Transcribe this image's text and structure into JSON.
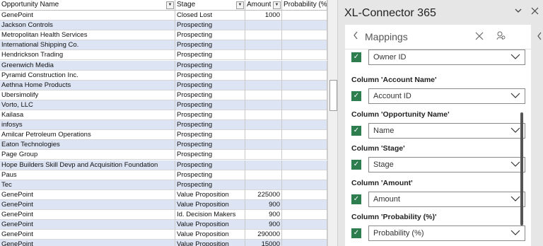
{
  "sheet": {
    "headers": [
      "Opportunity Name",
      "Stage",
      "Amount",
      "Probability (%"
    ],
    "rows": [
      [
        "GenePoint",
        "Closed Lost",
        "1000",
        ""
      ],
      [
        "Jackson Controls",
        "Prospecting",
        "",
        ""
      ],
      [
        "Metropolitan Health Services",
        "Prospecting",
        "",
        ""
      ],
      [
        "International Shipping Co.",
        "Prospecting",
        "",
        ""
      ],
      [
        "Hendrickson Trading",
        "Prospecting",
        "",
        ""
      ],
      [
        "Greenwich Media",
        "Prospecting",
        "",
        ""
      ],
      [
        "Pyramid Construction Inc.",
        "Prospecting",
        "",
        ""
      ],
      [
        "Aethna Home Products",
        "Prospecting",
        "",
        ""
      ],
      [
        "Ubersimolify",
        "Prospecting",
        "",
        ""
      ],
      [
        "Vorto, LLC",
        "Prospecting",
        "",
        ""
      ],
      [
        "Kailasa",
        "Prospecting",
        "",
        ""
      ],
      [
        "infosys",
        "Prospecting",
        "",
        ""
      ],
      [
        "Amilcar Petroleum Operations",
        "Prospecting",
        "",
        ""
      ],
      [
        "Eaton Technologies",
        "Prospecting",
        "",
        ""
      ],
      [
        "Page Group",
        "Prospecting",
        "",
        ""
      ],
      [
        "Hope Builders Skill Devp and Acquisition Foundation",
        "Prospecting",
        "",
        ""
      ],
      [
        "Paus",
        "Prospecting",
        "",
        ""
      ],
      [
        "Tec",
        "Prospecting",
        "",
        ""
      ],
      [
        "GenePoint",
        "Value Proposition",
        "225000",
        ""
      ],
      [
        "GenePoint",
        "Value Proposition",
        "900",
        ""
      ],
      [
        "GenePoint",
        "Id. Decision Makers",
        "900",
        ""
      ],
      [
        "GenePoint",
        "Value Proposition",
        "900",
        ""
      ],
      [
        "GenePoint",
        "Value Proposition",
        "290000",
        ""
      ],
      [
        "GenePoint",
        "Value Proposition",
        "15000",
        ""
      ]
    ],
    "cut_off_label": "on"
  },
  "pane": {
    "title": "XL-Connector 365",
    "panel_title": "Mappings",
    "first_select": "Owner ID",
    "mappings": [
      {
        "label": "Column 'Account Name'",
        "value": "Account ID"
      },
      {
        "label": "Column 'Opportunity Name'",
        "value": "Name"
      },
      {
        "label": "Column 'Stage'",
        "value": "Stage"
      },
      {
        "label": "Column 'Amount'",
        "value": "Amount"
      },
      {
        "label": "Column 'Probability (%)'",
        "value": "Probability (%)"
      }
    ]
  },
  "icons": {
    "pane_chevron": "chevron-down-icon",
    "pane_close": "close-icon",
    "back": "chevron-left-icon",
    "panel_close": "close-icon",
    "user_settings": "user-settings-icon",
    "checkbox": "checkmark-icon",
    "select_chevron": "chevron-down-icon"
  },
  "colors": {
    "band": "#dde4f3",
    "checkbox": "#2e7d4f",
    "pane_bg": "#e6e6e6"
  }
}
